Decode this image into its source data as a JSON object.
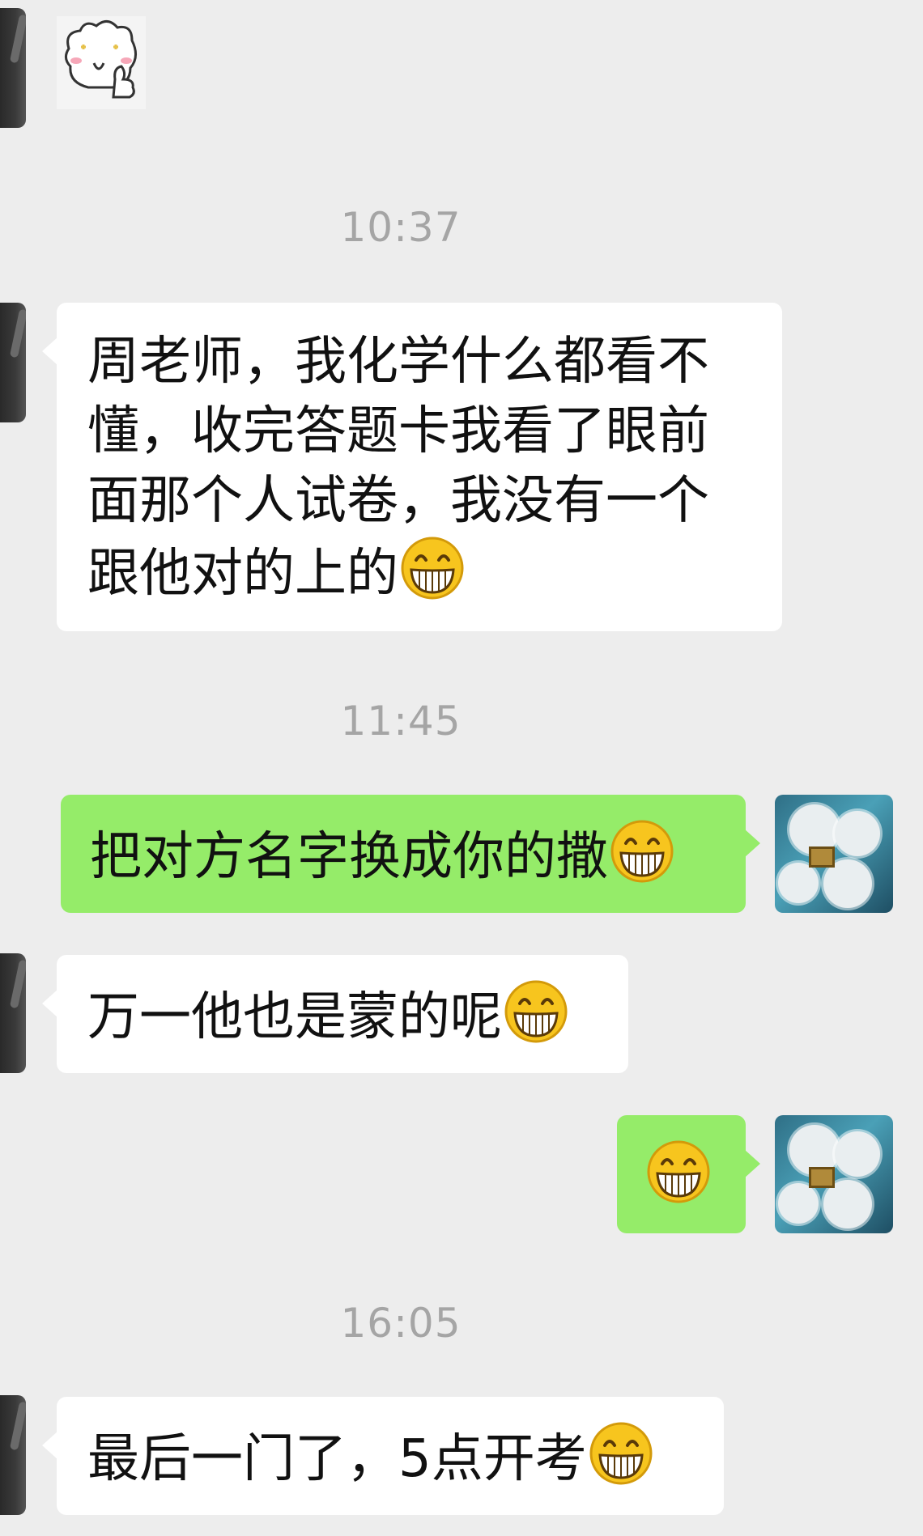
{
  "timestamps": [
    "10:37",
    "11:45",
    "16:05"
  ],
  "messages": [
    {
      "side": "left",
      "type": "sticker",
      "icon": "bear-thumbs-up-sticker"
    },
    {
      "side": "left",
      "type": "text",
      "text": "周老师，我化学什么都看不\n懂，收完答题卡我看了眼前\n面那个人试卷，我没有一个\n跟他对的上的",
      "emoji": "grin-emoji"
    },
    {
      "side": "right",
      "type": "text",
      "text": "把对方名字换成你的撒",
      "emoji": "grin-emoji"
    },
    {
      "side": "left",
      "type": "text",
      "text": "万一他也是蒙的呢",
      "emoji": "grin-emoji"
    },
    {
      "side": "right",
      "type": "emoji-only",
      "text": "",
      "emoji": "grin-emoji"
    },
    {
      "side": "left",
      "type": "text",
      "text": "最后一门了，5点开考",
      "emoji": "grin-emoji"
    }
  ],
  "colors": {
    "background": "#ededed",
    "left_bubble": "#ffffff",
    "right_bubble": "#95ec69",
    "timestamp": "#a5a5a5"
  }
}
